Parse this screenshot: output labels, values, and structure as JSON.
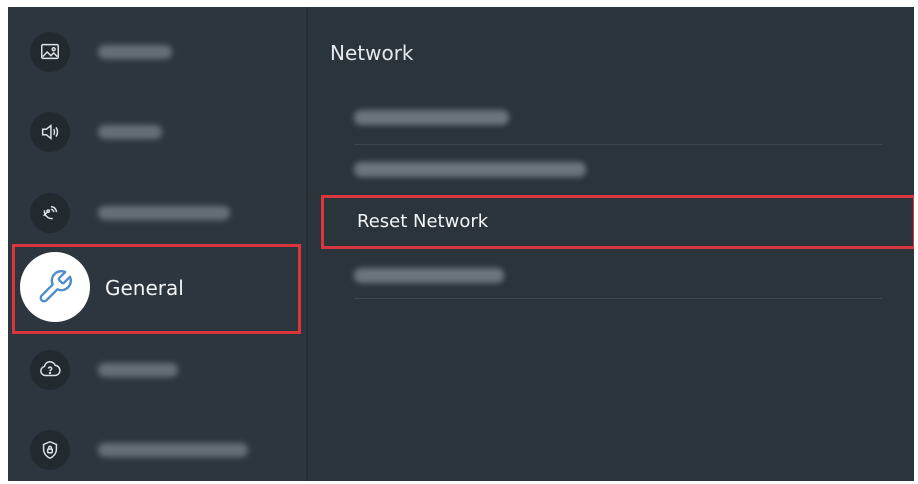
{
  "sidebar": {
    "items": [
      {
        "label": "",
        "icon": "picture-icon",
        "state": "blurred"
      },
      {
        "label": "",
        "icon": "sound-icon",
        "state": "blurred"
      },
      {
        "label": "",
        "icon": "broadcasting-icon",
        "state": "blurred"
      },
      {
        "label": "General",
        "icon": "wrench-icon",
        "state": "selected"
      },
      {
        "label": "",
        "icon": "support-icon",
        "state": "blurred"
      },
      {
        "label": "",
        "icon": "privacy-shield-icon",
        "state": "blurred"
      }
    ]
  },
  "panel": {
    "title": "Network",
    "items": [
      {
        "label": "",
        "state": "blurred"
      },
      {
        "label": "",
        "state": "blurred"
      },
      {
        "label": "Reset Network",
        "state": "highlighted"
      },
      {
        "label": "",
        "state": "blurred"
      }
    ]
  },
  "colors": {
    "background": "#2a333a",
    "highlight_border": "#d9373d",
    "text": "#f2f4f5"
  }
}
